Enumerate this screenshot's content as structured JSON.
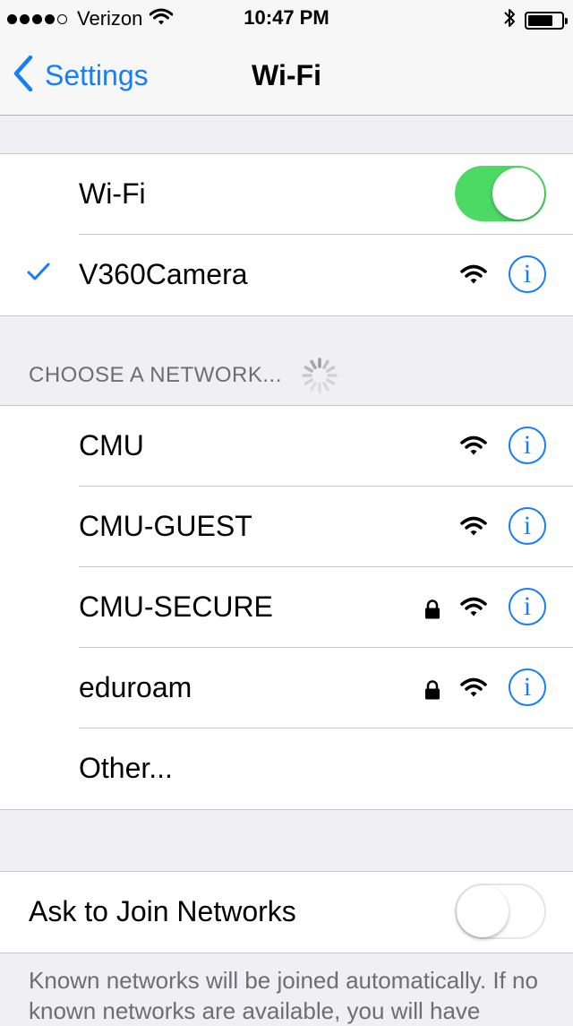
{
  "status_bar": {
    "signal_dots_filled": 4,
    "signal_dots_total": 5,
    "carrier": "Verizon",
    "time": "10:47 PM",
    "battery_level": 0.75
  },
  "nav": {
    "back_label": "Settings",
    "title": "Wi-Fi"
  },
  "wifi_section": {
    "toggle_label": "Wi-Fi",
    "toggle_on": true,
    "connected_network": "V360Camera"
  },
  "choose_header": "CHOOSE A NETWORK...",
  "networks": [
    {
      "name": "CMU",
      "locked": false
    },
    {
      "name": "CMU-GUEST",
      "locked": false
    },
    {
      "name": "CMU-SECURE",
      "locked": true
    },
    {
      "name": "eduroam",
      "locked": true
    }
  ],
  "other_label": "Other...",
  "ask_to_join": {
    "label": "Ask to Join Networks",
    "toggle_on": false
  },
  "footer": "Known networks will be joined automatically. If no known networks are available, you will have",
  "colors": {
    "accent": "#157efb",
    "toggle_on": "#4cd964",
    "background": "#efeff4"
  },
  "icons": {
    "back": "chevron-left-icon",
    "checkmark": "checkmark-icon",
    "wifi": "wifi-signal-icon",
    "lock": "lock-icon",
    "info": "info-icon",
    "spinner": "activity-spinner-icon",
    "bluetooth": "bluetooth-icon",
    "battery": "battery-icon"
  },
  "info_glyph": "i"
}
